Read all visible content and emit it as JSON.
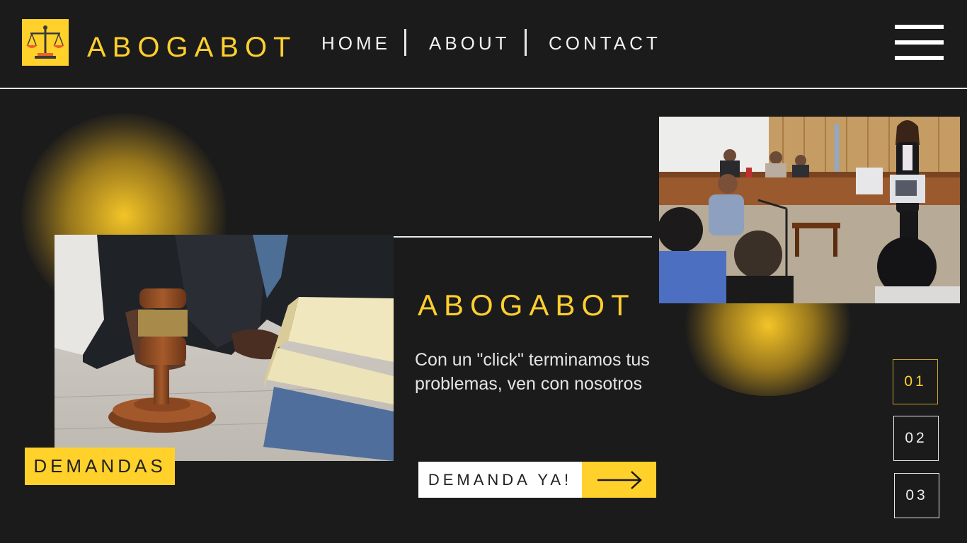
{
  "header": {
    "brand": "ABOGABOT",
    "nav": [
      {
        "label": "HOME"
      },
      {
        "label": "ABOUT"
      },
      {
        "label": "CONTACT"
      }
    ]
  },
  "hero": {
    "tag": "DEMANDAS",
    "title": "ABOGABOT",
    "subtitle": "Con un \"click\" terminamos tus problemas, ven con nosotros",
    "cta_label": "DEMANDA YA!"
  },
  "pager": [
    {
      "label": "01",
      "active": true
    },
    {
      "label": "02",
      "active": false
    },
    {
      "label": "03",
      "active": false
    }
  ],
  "colors": {
    "background": "#1b1b1b",
    "accent": "#ffd12a",
    "text": "#ffffff"
  },
  "icons": {
    "logo": "scales-of-justice-icon",
    "menu": "hamburger-menu-icon",
    "cta": "arrow-right-icon"
  }
}
